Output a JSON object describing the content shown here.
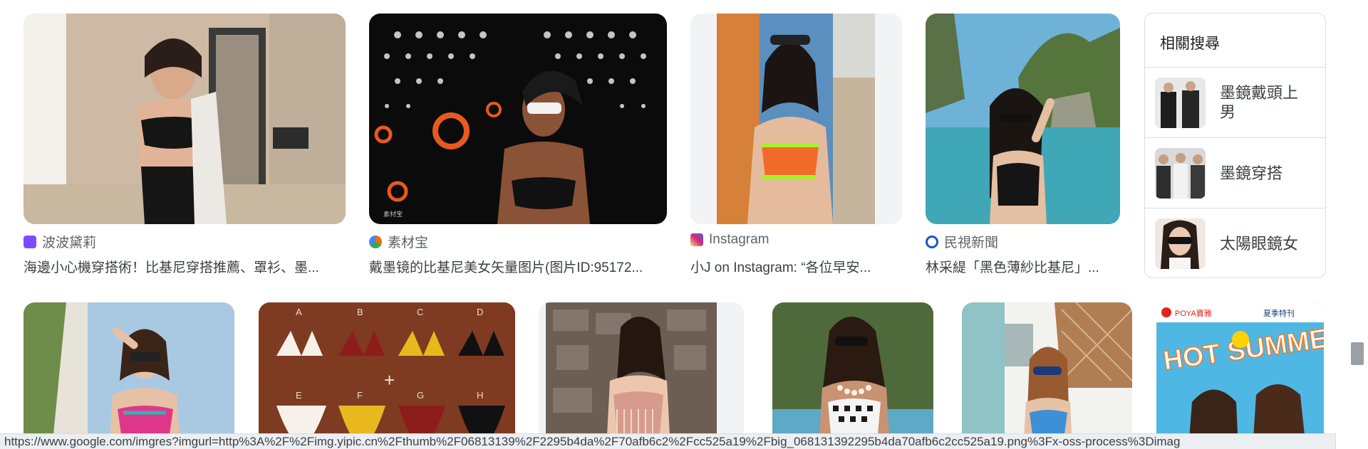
{
  "results_row1": [
    {
      "source": "波波黛莉",
      "title": "海邊小心機穿搭術！比基尼穿搭推薦、罩衫、墨...",
      "favicon_color": "#7c4dff"
    },
    {
      "source": "素材宝",
      "title": "戴墨镜的比基尼美女矢量图片(图片ID:95172...",
      "favicon_color": "#e8710a"
    },
    {
      "source": "Instagram",
      "title": "小J on Instagram: “各位早安...",
      "favicon_color": "#d62976"
    },
    {
      "source": "民視新聞",
      "title": "林采緹「黑色薄紗比基尼」...",
      "favicon_color": "#1a56c4"
    }
  ],
  "related": {
    "heading": "相關搜尋",
    "items": [
      {
        "label": "墨鏡戴頭上男"
      },
      {
        "label": "墨鏡穿搭"
      },
      {
        "label": "太陽眼鏡女"
      }
    ]
  },
  "results_row2": [
    {
      "name": "bikini-pose-image"
    },
    {
      "name": "bikini-chart-image",
      "letters": [
        "A",
        "B",
        "C",
        "D",
        "E",
        "F",
        "G",
        "H"
      ]
    },
    {
      "name": "fringe-bikini-image"
    },
    {
      "name": "checkered-bikini-image"
    },
    {
      "name": "blue-bikini-image"
    },
    {
      "name": "hot-summer-ad-image",
      "brand": "POYA寶雅",
      "banner": "夏季特刊",
      "headline": "HOT SUMMER"
    }
  ],
  "status_url": "https://www.google.com/imgres?imgurl=http%3A%2F%2Fimg.yipic.cn%2Fthumb%2F06813139%2F2295b4da%2F70afb6c2%2Fcc525a19%2Fbig_068131392295b4da70afb6c2cc525a19.png%3Fx-oss-process%3Dimag"
}
